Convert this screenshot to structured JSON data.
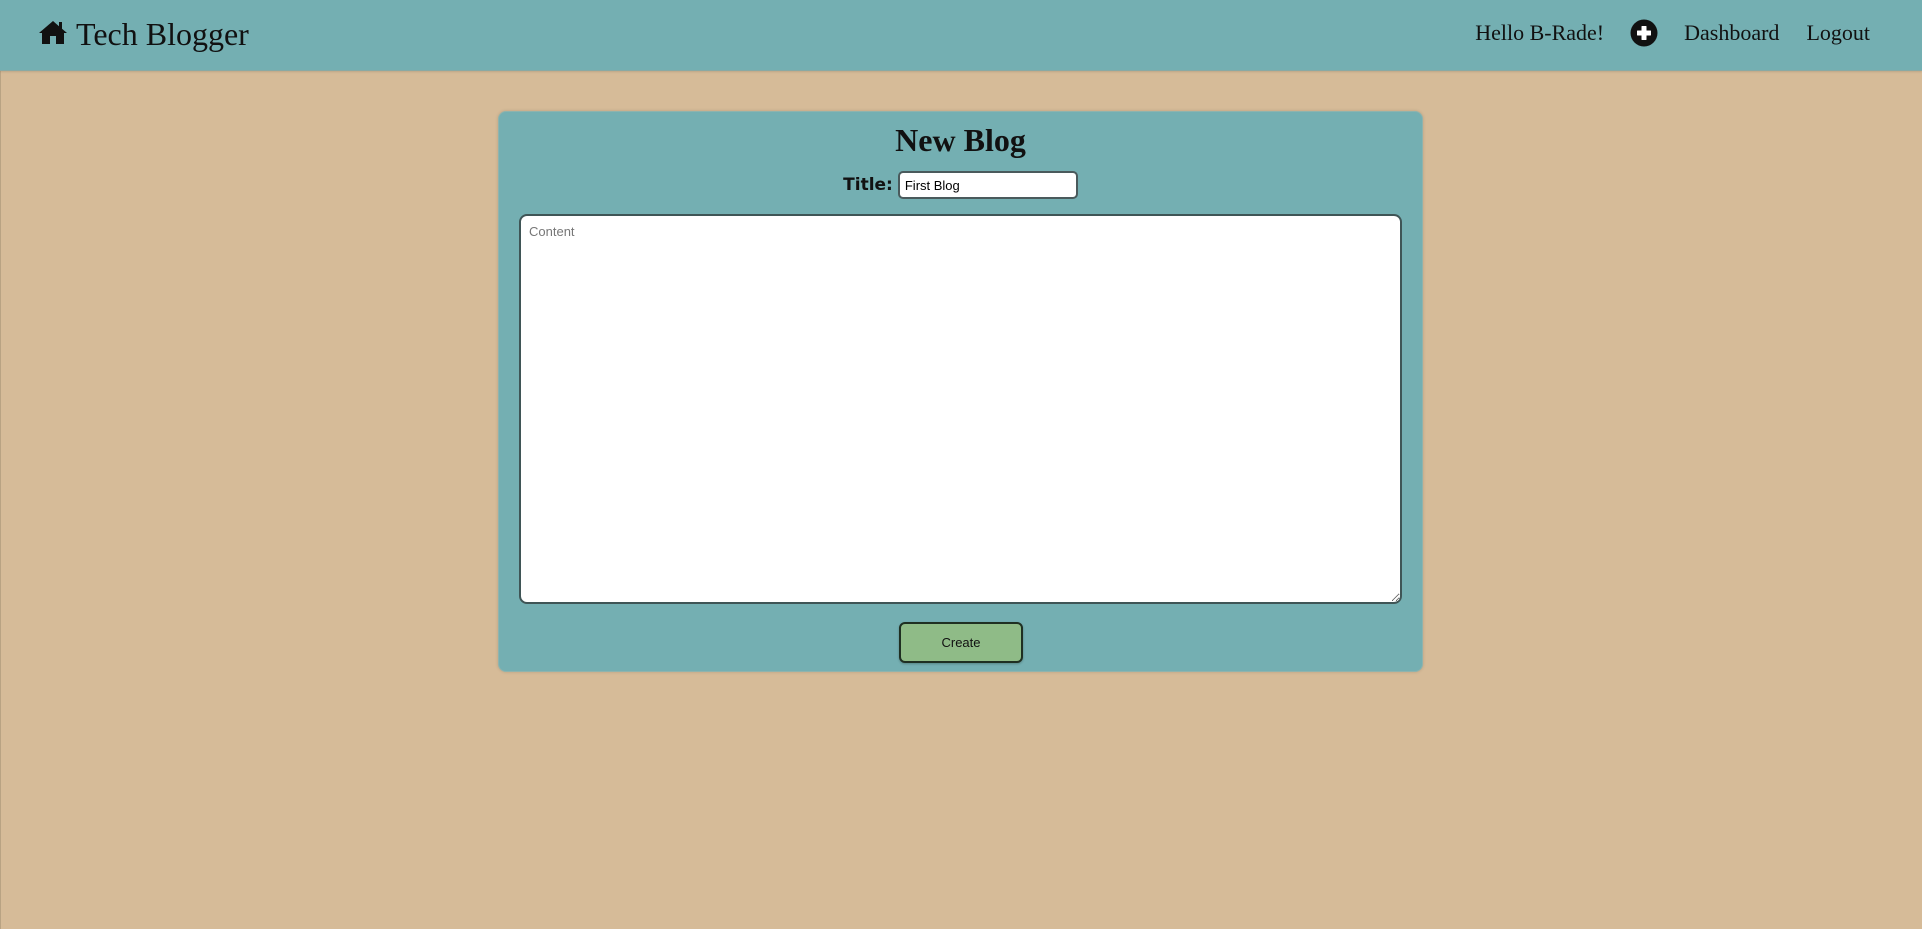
{
  "navbar": {
    "brand_text": "Tech Blogger",
    "brand_icon": "home-icon",
    "greeting": "Hello B-Rade!",
    "add_icon": "plus-circle-icon",
    "links": [
      {
        "label": "Dashboard"
      },
      {
        "label": "Logout"
      }
    ]
  },
  "form": {
    "heading": "New Blog",
    "title_label": "Title:",
    "title_value": "First Blog",
    "content_placeholder": "Content",
    "content_value": "",
    "submit_label": "Create"
  },
  "colors": {
    "page_background": "#d6bb98",
    "navbar_background": "#74afb2",
    "card_background": "#74afb2",
    "button_background": "#8fbb87"
  }
}
